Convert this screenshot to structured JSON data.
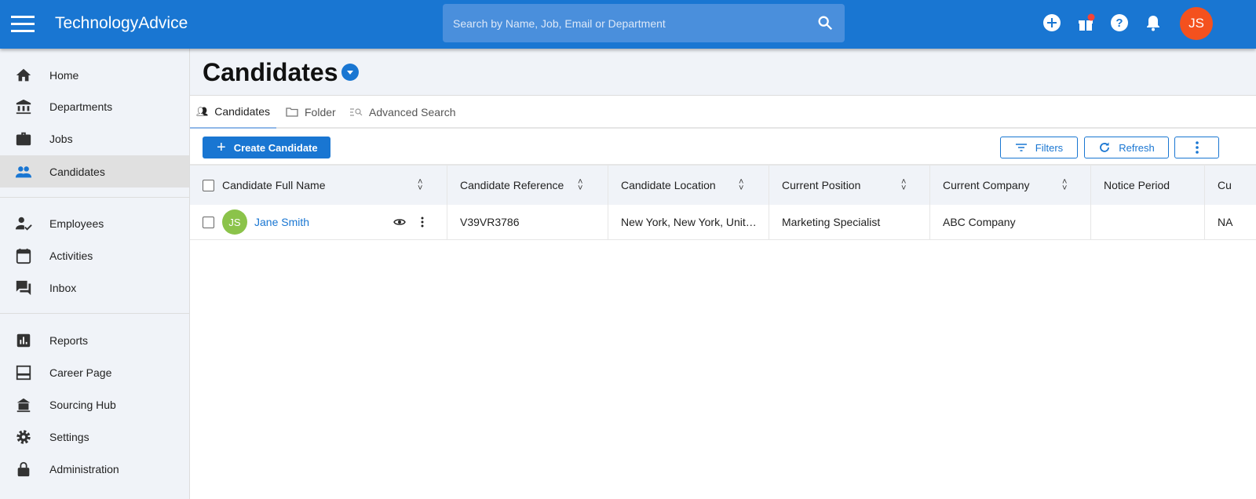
{
  "header": {
    "brand": "TechnologyAdvice",
    "search_placeholder": "Search by Name, Job, Email or Department",
    "user_initials": "JS",
    "accent": "#1976d2",
    "notification_dot": "#f44336"
  },
  "sidebar": {
    "items": [
      {
        "label": "Home",
        "icon": "home-icon"
      },
      {
        "label": "Departments",
        "icon": "bank-icon"
      },
      {
        "label": "Jobs",
        "icon": "briefcase-icon"
      },
      {
        "label": "Candidates",
        "icon": "people-icon",
        "active": true
      },
      {
        "label": "Employees",
        "icon": "person-check-icon"
      },
      {
        "label": "Activities",
        "icon": "calendar-icon"
      },
      {
        "label": "Inbox",
        "icon": "chat-icon"
      },
      {
        "label": "Reports",
        "icon": "bar-chart-icon"
      },
      {
        "label": "Career Page",
        "icon": "web-page-icon"
      },
      {
        "label": "Sourcing Hub",
        "icon": "hub-icon"
      },
      {
        "label": "Settings",
        "icon": "gear-icon"
      },
      {
        "label": "Administration",
        "icon": "lock-icon"
      }
    ]
  },
  "page": {
    "title": "Candidates"
  },
  "tabs": [
    {
      "label": "Candidates",
      "active": true
    },
    {
      "label": "Folder"
    },
    {
      "label": "Advanced Search"
    }
  ],
  "toolbar": {
    "create": "Create Candidate",
    "filters": "Filters",
    "refresh": "Refresh"
  },
  "table": {
    "columns": [
      "Candidate Full Name",
      "Candidate Reference",
      "Candidate Location",
      "Current Position",
      "Current Company",
      "Notice Period",
      "Cu"
    ],
    "rows": [
      {
        "initials": "JS",
        "name": "Jane Smith",
        "reference": "V39VR3786",
        "location": "New York, New York, Unit…",
        "position": "Marketing Specialist",
        "company": "ABC Company",
        "notice": "",
        "next": "NA"
      }
    ]
  }
}
